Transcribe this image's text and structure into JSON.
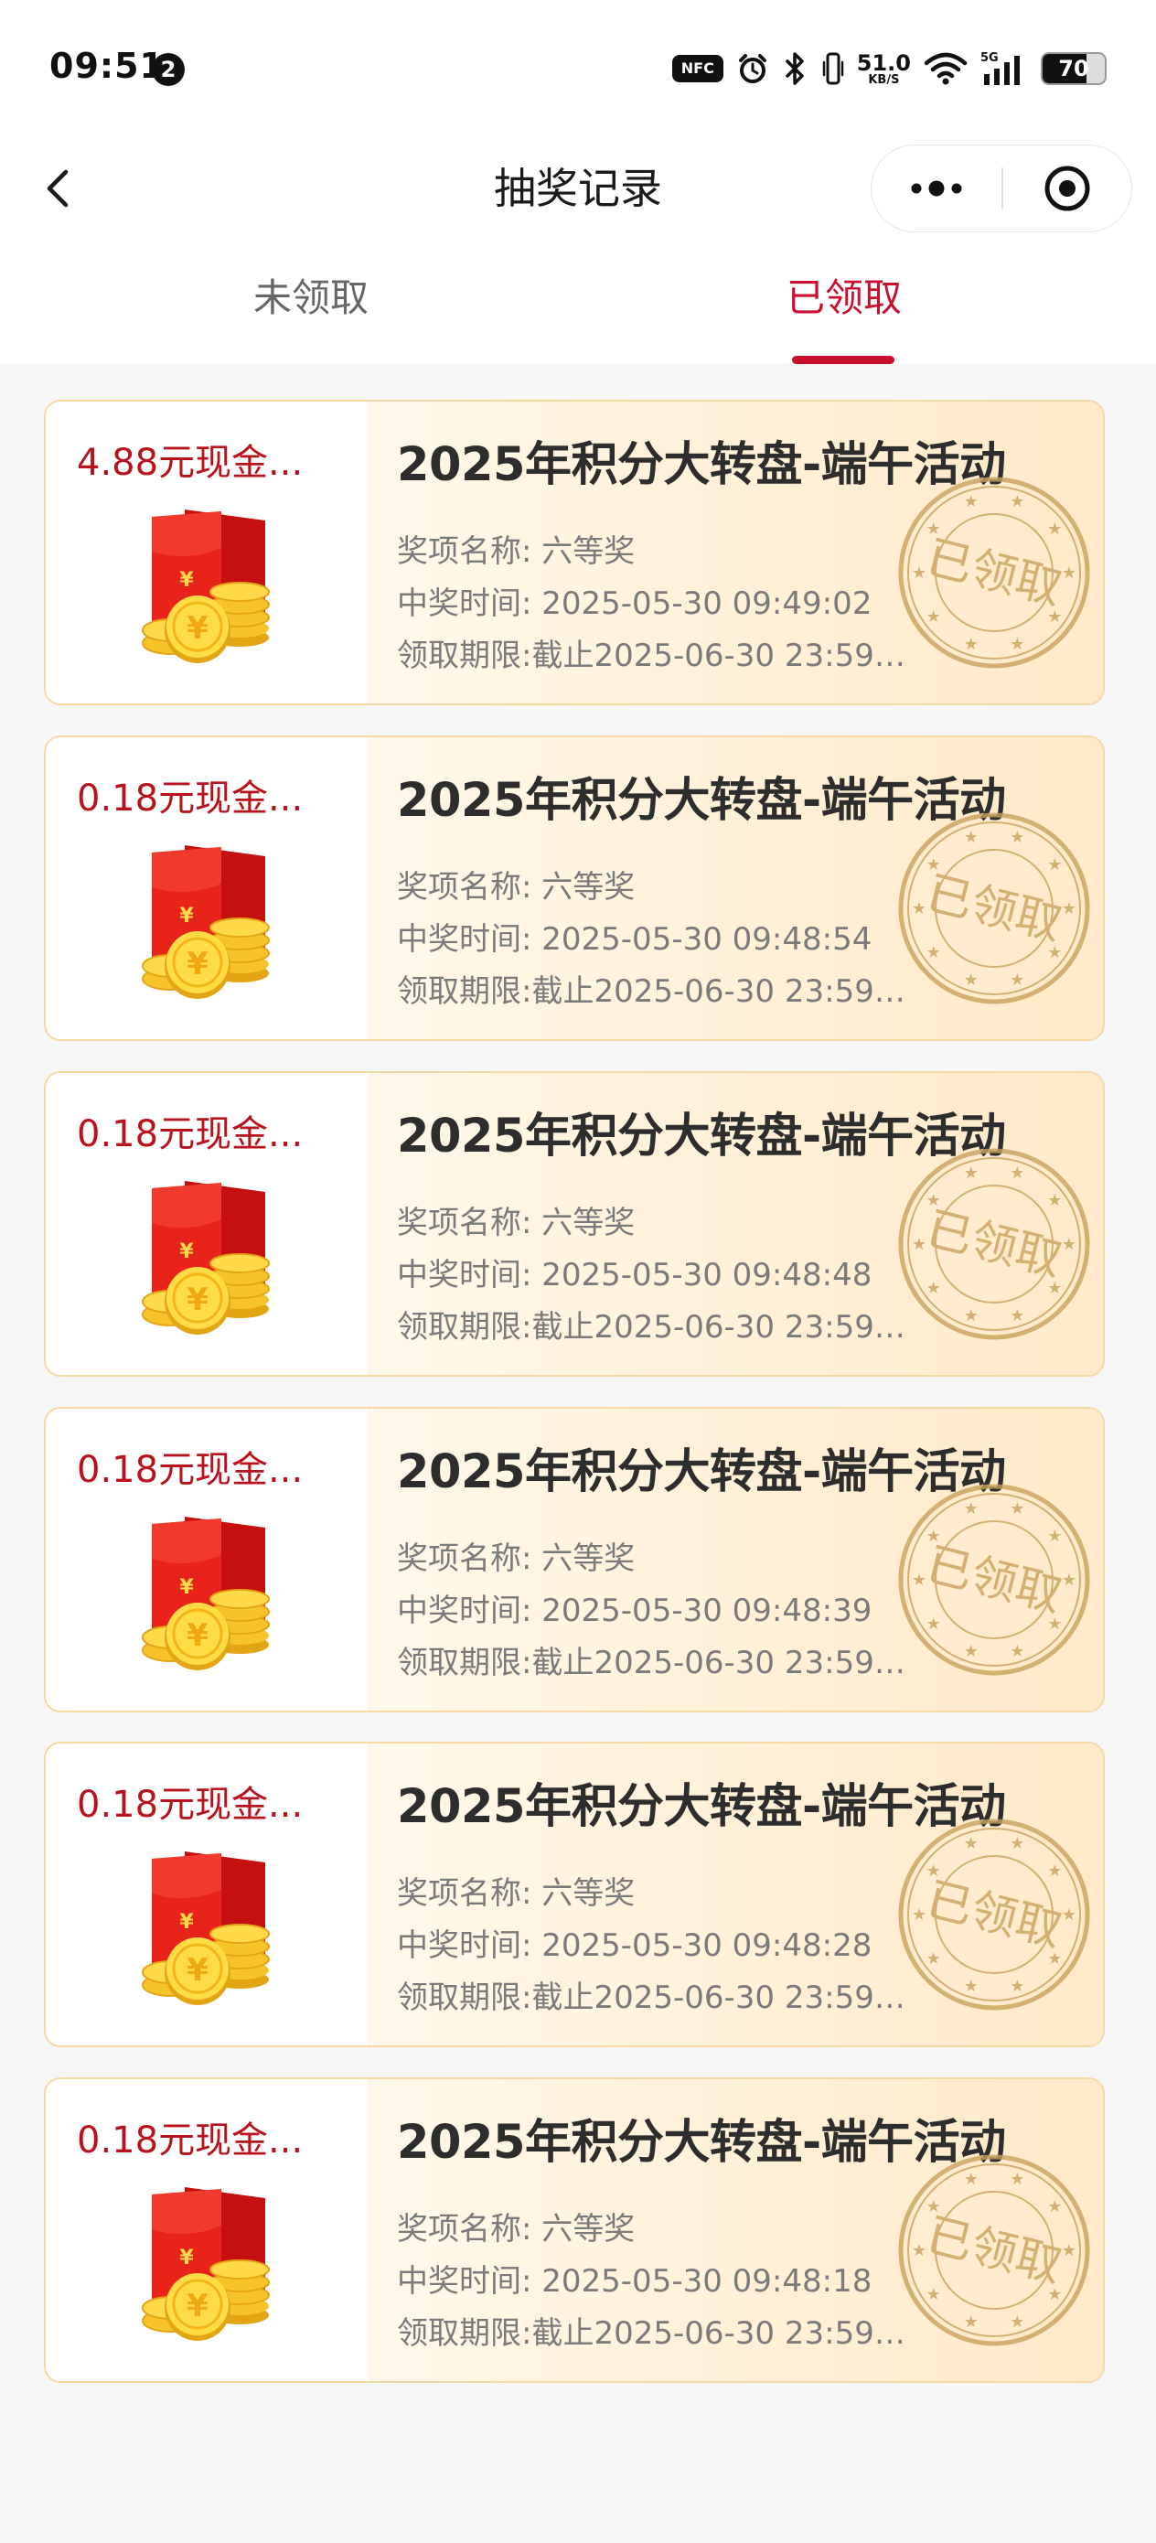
{
  "status_bar": {
    "time": "09:51",
    "notification_count": "2",
    "nfc_label": "NFC",
    "net_speed_value": "51.0",
    "net_speed_unit": "KB/S",
    "signal_type": "5G",
    "battery_level": "70",
    "battery_fraction": 0.7
  },
  "nav": {
    "title": "抽奖记录"
  },
  "tabs": {
    "items": [
      {
        "label": "未领取",
        "active": false
      },
      {
        "label": "已领取",
        "active": true
      }
    ]
  },
  "colors": {
    "accent": "#c8102e",
    "prize_text": "#b8121d",
    "card_border": "#f6d9a2",
    "stamp": "#c9a25a",
    "page_background": "#f6f6f6"
  },
  "stamp_text": "已领取",
  "records": [
    {
      "prize": "4.88元现金...",
      "title": "2025年积分大转盘-端午活动",
      "prize_name": "奖项名称: 六等奖",
      "win_time": "中奖时间: 2025-05-30 09:49:02",
      "deadline": "领取期限:截止2025-06-30 23:59:...",
      "icon": "red-packet-with-coins-icon"
    },
    {
      "prize": "0.18元现金...",
      "title": "2025年积分大转盘-端午活动",
      "prize_name": "奖项名称: 六等奖",
      "win_time": "中奖时间: 2025-05-30 09:48:54",
      "deadline": "领取期限:截止2025-06-30 23:59:...",
      "icon": "red-packet-with-coins-icon"
    },
    {
      "prize": "0.18元现金...",
      "title": "2025年积分大转盘-端午活动",
      "prize_name": "奖项名称: 六等奖",
      "win_time": "中奖时间: 2025-05-30 09:48:48",
      "deadline": "领取期限:截止2025-06-30 23:59:...",
      "icon": "red-packet-with-coins-icon"
    },
    {
      "prize": "0.18元现金...",
      "title": "2025年积分大转盘-端午活动",
      "prize_name": "奖项名称: 六等奖",
      "win_time": "中奖时间: 2025-05-30 09:48:39",
      "deadline": "领取期限:截止2025-06-30 23:59:...",
      "icon": "red-packet-with-coins-icon"
    },
    {
      "prize": "0.18元现金...",
      "title": "2025年积分大转盘-端午活动",
      "prize_name": "奖项名称: 六等奖",
      "win_time": "中奖时间: 2025-05-30 09:48:28",
      "deadline": "领取期限:截止2025-06-30 23:59:...",
      "icon": "red-packet-with-coins-icon"
    },
    {
      "prize": "0.18元现金...",
      "title": "2025年积分大转盘-端午活动",
      "prize_name": "奖项名称: 六等奖",
      "win_time": "中奖时间: 2025-05-30 09:48:18",
      "deadline": "领取期限:截止2025-06-30 23:59:...",
      "icon": "red-packet-with-coins-icon"
    }
  ]
}
